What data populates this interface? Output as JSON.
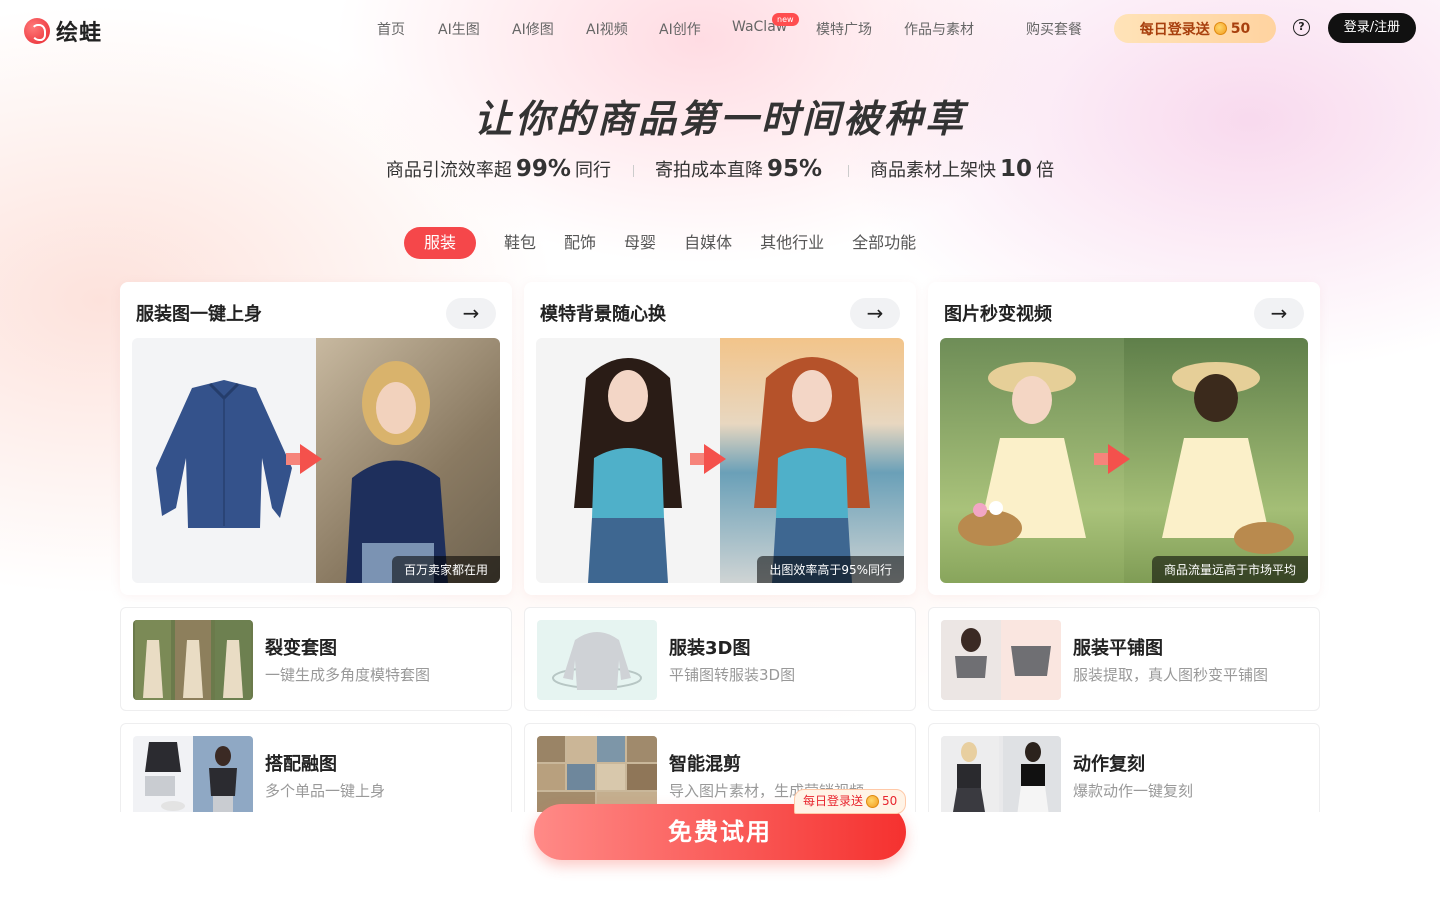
{
  "app": {
    "name": "绘蛙"
  },
  "nav": {
    "items": [
      "首页",
      "AI生图",
      "AI修图",
      "AI视频",
      "AI创作",
      "WaClaw",
      "模特广场",
      "作品与素材",
      "购买套餐"
    ],
    "new_badge": "new",
    "daily_login": {
      "label": "每日登录送",
      "amount": "50"
    },
    "help": "?",
    "login": "登录/注册"
  },
  "hero": {
    "title": "让你的商品第一时间被种草",
    "stats": [
      {
        "pre": "商品引流效率超",
        "num": "99%",
        "post": "同行"
      },
      {
        "pre": "寄拍成本直降",
        "num": "95%",
        "post": ""
      },
      {
        "pre": "商品素材上架快",
        "num": "10",
        "post": "倍"
      }
    ]
  },
  "tabs": [
    "服装",
    "鞋包",
    "配饰",
    "母婴",
    "自媒体",
    "其他行业",
    "全部功能"
  ],
  "active_tab": "服装",
  "feature_cards": [
    {
      "title": "服装图一键上身",
      "caption": "百万卖家都在用"
    },
    {
      "title": "模特背景随心换",
      "caption": "出图效率高于95%同行"
    },
    {
      "title": "图片秒变视频",
      "caption": "商品流量远高于市场平均"
    }
  ],
  "items": [
    {
      "title": "裂变套图",
      "desc": "一键生成多角度模特套图"
    },
    {
      "title": "服装3D图",
      "desc": "平铺图转服装3D图"
    },
    {
      "title": "服装平铺图",
      "desc": "服装提取，真人图秒变平铺图"
    },
    {
      "title": "搭配融图",
      "desc": "多个单品一键上身"
    },
    {
      "title": "智能混剪",
      "desc": "导入图片素材，生成营销视频"
    },
    {
      "title": "动作复刻",
      "desc": "爆款动作一键复刻"
    }
  ],
  "cta": {
    "label": "免费试用",
    "badge_label": "每日登录送",
    "badge_amount": "50"
  },
  "colors": {
    "accent": "#f5474a",
    "dark": "#111111",
    "gold": "#a8400e"
  }
}
